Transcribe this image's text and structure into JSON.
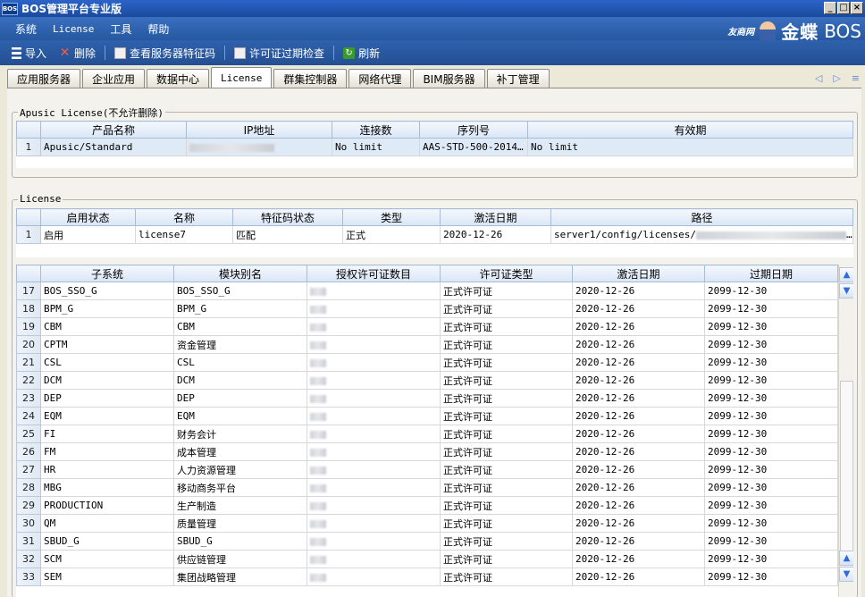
{
  "window": {
    "app_logo_text": "BOS",
    "title": "BOS管理平台专业版",
    "buttons": {
      "minimize": "_",
      "maximize": "□",
      "close": "×"
    }
  },
  "menu": [
    "系统",
    "License",
    "工具",
    "帮助"
  ],
  "brand": {
    "youshang": "友商网",
    "kingdee": "金蝶",
    "bos": "BOS"
  },
  "toolbar": {
    "import": "导入",
    "delete": "删除",
    "view_server_feature_code": "查看服务器特征码",
    "license_expiry_check": "许可证过期检查",
    "refresh": "刷新"
  },
  "tabs": [
    "应用服务器",
    "企业应用",
    "数据中心",
    "License",
    "群集控制器",
    "网络代理",
    "BIM服务器",
    "补丁管理"
  ],
  "active_tab": "License",
  "apusic": {
    "legend": "Apusic License(不允许删除)",
    "columns": [
      "产品名称",
      "IP地址",
      "连接数",
      "序列号",
      "有效期"
    ],
    "rows": [
      {
        "num": "1",
        "product": "Apusic/Standard",
        "connections": "No limit",
        "serial": "AAS-STD-500-2014...",
        "valid": "No limit"
      }
    ]
  },
  "license": {
    "legend": "License",
    "columns": [
      "启用状态",
      "名称",
      "特征码状态",
      "类型",
      "激活日期",
      "路径"
    ],
    "rows": [
      {
        "num": "1",
        "status": "启用",
        "name": "license7",
        "feature": "匹配",
        "type": "正式",
        "activated": "2020-12-26",
        "path_prefix": "server1/config/licenses/",
        "path_suffix": "..."
      }
    ]
  },
  "subsystems": {
    "columns": [
      "子系统",
      "模块别名",
      "授权许可证数目",
      "许可证类型",
      "激活日期",
      "过期日期"
    ],
    "rows": [
      {
        "num": "17",
        "sub": "BOS_SSO_G",
        "alias": "BOS_SSO_G",
        "type": "正式许可证",
        "activated": "2020-12-26",
        "expires": "2099-12-30"
      },
      {
        "num": "18",
        "sub": "BPM_G",
        "alias": "BPM_G",
        "type": "正式许可证",
        "activated": "2020-12-26",
        "expires": "2099-12-30"
      },
      {
        "num": "19",
        "sub": "CBM",
        "alias": "CBM",
        "type": "正式许可证",
        "activated": "2020-12-26",
        "expires": "2099-12-30"
      },
      {
        "num": "20",
        "sub": "CPTM",
        "alias": "资金管理",
        "type": "正式许可证",
        "activated": "2020-12-26",
        "expires": "2099-12-30"
      },
      {
        "num": "21",
        "sub": "CSL",
        "alias": "CSL",
        "type": "正式许可证",
        "activated": "2020-12-26",
        "expires": "2099-12-30"
      },
      {
        "num": "22",
        "sub": "DCM",
        "alias": "DCM",
        "type": "正式许可证",
        "activated": "2020-12-26",
        "expires": "2099-12-30"
      },
      {
        "num": "23",
        "sub": "DEP",
        "alias": "DEP",
        "type": "正式许可证",
        "activated": "2020-12-26",
        "expires": "2099-12-30"
      },
      {
        "num": "24",
        "sub": "EQM",
        "alias": "EQM",
        "type": "正式许可证",
        "activated": "2020-12-26",
        "expires": "2099-12-30"
      },
      {
        "num": "25",
        "sub": "FI",
        "alias": "财务会计",
        "type": "正式许可证",
        "activated": "2020-12-26",
        "expires": "2099-12-30"
      },
      {
        "num": "26",
        "sub": "FM",
        "alias": "成本管理",
        "type": "正式许可证",
        "activated": "2020-12-26",
        "expires": "2099-12-30"
      },
      {
        "num": "27",
        "sub": "HR",
        "alias": "人力资源管理",
        "type": "正式许可证",
        "activated": "2020-12-26",
        "expires": "2099-12-30"
      },
      {
        "num": "28",
        "sub": "MBG",
        "alias": "移动商务平台",
        "type": "正式许可证",
        "activated": "2020-12-26",
        "expires": "2099-12-30"
      },
      {
        "num": "29",
        "sub": "PRODUCTION",
        "alias": "生产制造",
        "type": "正式许可证",
        "activated": "2020-12-26",
        "expires": "2099-12-30"
      },
      {
        "num": "30",
        "sub": "QM",
        "alias": "质量管理",
        "type": "正式许可证",
        "activated": "2020-12-26",
        "expires": "2099-12-30"
      },
      {
        "num": "31",
        "sub": "SBUD_G",
        "alias": "SBUD_G",
        "type": "正式许可证",
        "activated": "2020-12-26",
        "expires": "2099-12-30"
      },
      {
        "num": "32",
        "sub": "SCM",
        "alias": "供应链管理",
        "type": "正式许可证",
        "activated": "2020-12-26",
        "expires": "2099-12-30"
      },
      {
        "num": "33",
        "sub": "SEM",
        "alias": "集团战略管理",
        "type": "正式许可证",
        "activated": "2020-12-26",
        "expires": "2099-12-30"
      }
    ]
  },
  "icons": {
    "tab_prev": "◁",
    "tab_next": "▷",
    "tab_menu": "≡",
    "scroll_up": "▲",
    "scroll_down": "▼",
    "delete": "✕",
    "refresh": "↻"
  }
}
